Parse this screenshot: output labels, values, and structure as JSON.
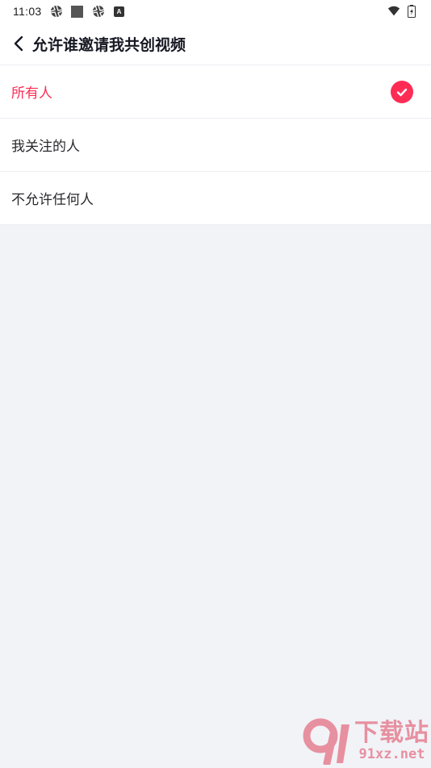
{
  "status_bar": {
    "time": "11:03",
    "icons": [
      "aperture-icon",
      "square-icon",
      "aperture-icon",
      "a-badge-icon",
      "wifi-icon",
      "battery-icon"
    ],
    "a_badge": "A"
  },
  "header": {
    "title": "允许谁邀请我共创视频"
  },
  "options": [
    {
      "label": "所有人",
      "selected": true
    },
    {
      "label": "我关注的人",
      "selected": false
    },
    {
      "label": "不允许任何人",
      "selected": false
    }
  ],
  "watermark": {
    "logo": "9",
    "big_text": "下载站",
    "small_text": "91xz.net"
  },
  "colors": {
    "accent": "#fe2c55",
    "background": "#f1f3f7",
    "surface": "#ffffff",
    "text": "#161823"
  }
}
